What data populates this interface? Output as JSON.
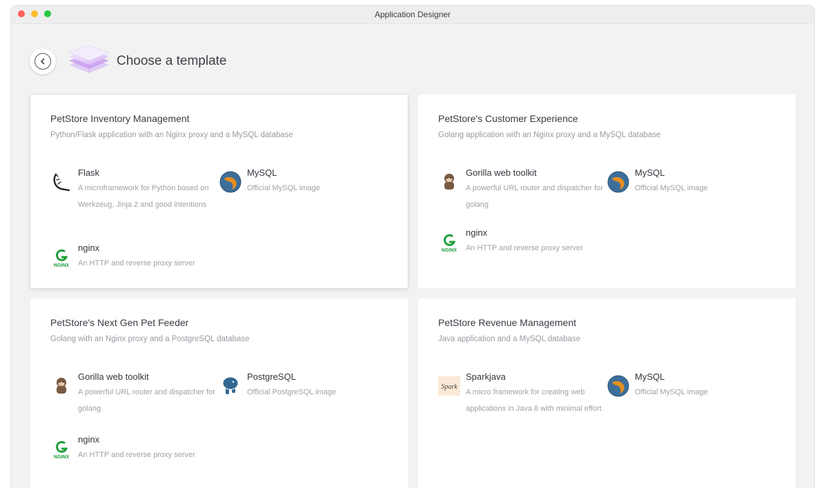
{
  "window": {
    "title": "Application Designer"
  },
  "header": {
    "title": "Choose a template"
  },
  "templates": [
    {
      "title": "PetStore Inventory Management",
      "subtitle": "Python/Flask application with an Nginx proxy and a MySQL database",
      "components": [
        {
          "name": "Flask",
          "description": "A microframework for Python based on Werkzeug, Jinja 2 and good intentions",
          "icon": "flask-icon"
        },
        {
          "name": "MySQL",
          "description": "Official MySQL image",
          "icon": "mysql-icon"
        },
        {
          "name": "nginx",
          "description": "An HTTP and reverse proxy server",
          "icon": "nginx-icon"
        }
      ]
    },
    {
      "title": "PetStore's Customer Experience",
      "subtitle": "Golang application with an Nginx proxy and a MySQL database",
      "components": [
        {
          "name": "Gorilla web toolkit",
          "description": "A powerful URL router and dispatcher for golang",
          "icon": "gorilla-icon"
        },
        {
          "name": "MySQL",
          "description": "Official MySQL image",
          "icon": "mysql-icon"
        },
        {
          "name": "nginx",
          "description": "An HTTP and reverse proxy server",
          "icon": "nginx-icon"
        }
      ]
    },
    {
      "title": "PetStore's Next Gen Pet Feeder",
      "subtitle": "Golang with an Nginx proxy and a PostgreSQL database",
      "components": [
        {
          "name": "Gorilla web toolkit",
          "description": "A powerful URL router and dispatcher for golang",
          "icon": "gorilla-icon"
        },
        {
          "name": "PostgreSQL",
          "description": "Official PostgreSQL image",
          "icon": "postgresql-icon"
        },
        {
          "name": "nginx",
          "description": "An HTTP and reverse proxy server",
          "icon": "nginx-icon"
        }
      ]
    },
    {
      "title": "PetStore Revenue Management",
      "subtitle": "Java application and a MySQL database",
      "components": [
        {
          "name": "Sparkjava",
          "description": "A micro framework for creating web applications in Java 8 with minimal effort",
          "icon": "sparkjava-icon",
          "icon_text": "Spark"
        },
        {
          "name": "MySQL",
          "description": "Official MySQL image",
          "icon": "mysql-icon"
        }
      ]
    }
  ],
  "icon_labels": {
    "nginx": "NGINX"
  },
  "colors": {
    "nginx_green": "#1f9d3a",
    "mysql_blue": "#3d6f9b",
    "mysql_orange": "#e48e1f",
    "postgres_blue": "#336791",
    "illustration_purple": "#b784e6",
    "window_bg": "#f2f2f2",
    "card_bg": "#ffffff"
  }
}
